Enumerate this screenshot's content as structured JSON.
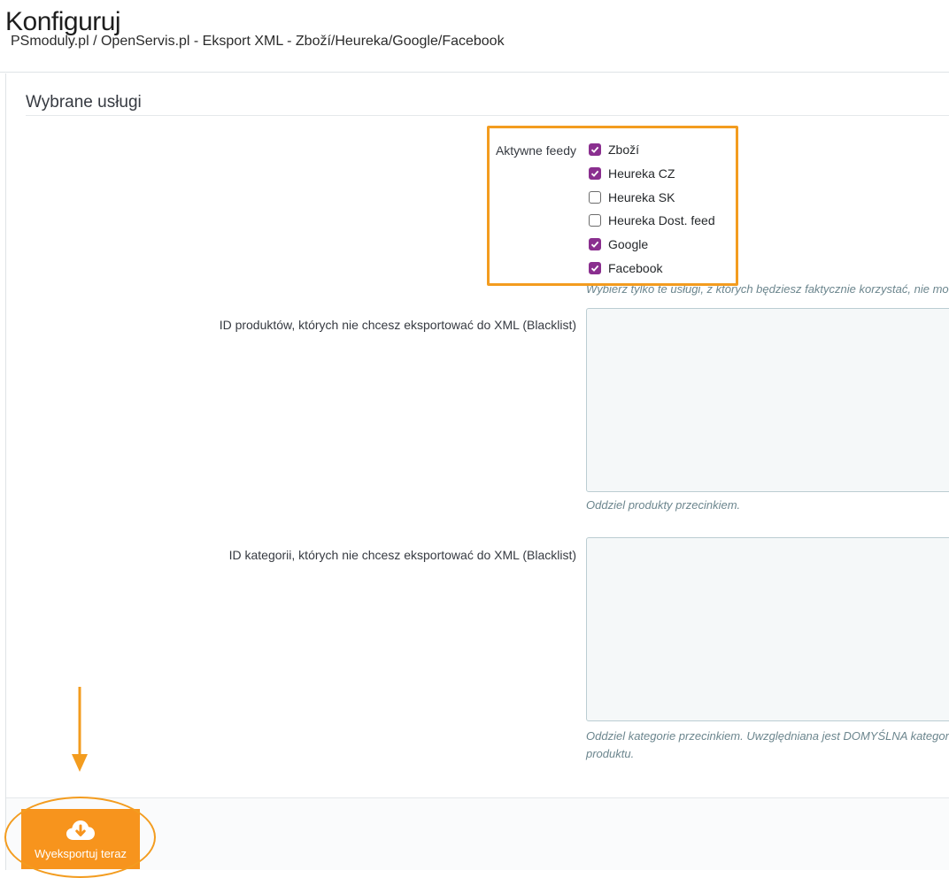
{
  "header": {
    "title": "Konfiguruj",
    "breadcrumb": "PSmoduly.pl / OpenServis.pl - Eksport XML - Zboží/Heureka/Google/Facebook"
  },
  "panel": {
    "heading": "Wybrane usługi",
    "feeds": {
      "label": "Aktywne feedy",
      "options": [
        {
          "label": "Zboží",
          "checked": true
        },
        {
          "label": "Heureka CZ",
          "checked": true
        },
        {
          "label": "Heureka SK",
          "checked": false
        },
        {
          "label": "Heureka Dost. feed",
          "checked": false
        },
        {
          "label": "Google",
          "checked": true
        },
        {
          "label": "Facebook",
          "checked": true
        }
      ],
      "help": "Wybierz tylko te usługi, z których będziesz faktycznie korzystać, nie mo"
    },
    "product_blacklist": {
      "label": "ID produktów, których nie chcesz eksportować do XML (Blacklist)",
      "value": "",
      "help": "Oddziel produkty przecinkiem."
    },
    "category_blacklist": {
      "label": "ID kategorii, których nie chcesz eksportować do XML (Blacklist)",
      "value": "",
      "help": "Oddziel kategorie przecinkiem. Uwzględniana jest DOMYŚLNA kategori produktu."
    }
  },
  "footer": {
    "export_label": "Wyeksportuj teraz",
    "export_icon": "cloud-download-icon"
  },
  "colors": {
    "accent": "#f7941d",
    "highlight": "#f39c1f",
    "checkbox": "#8a2f8f"
  }
}
